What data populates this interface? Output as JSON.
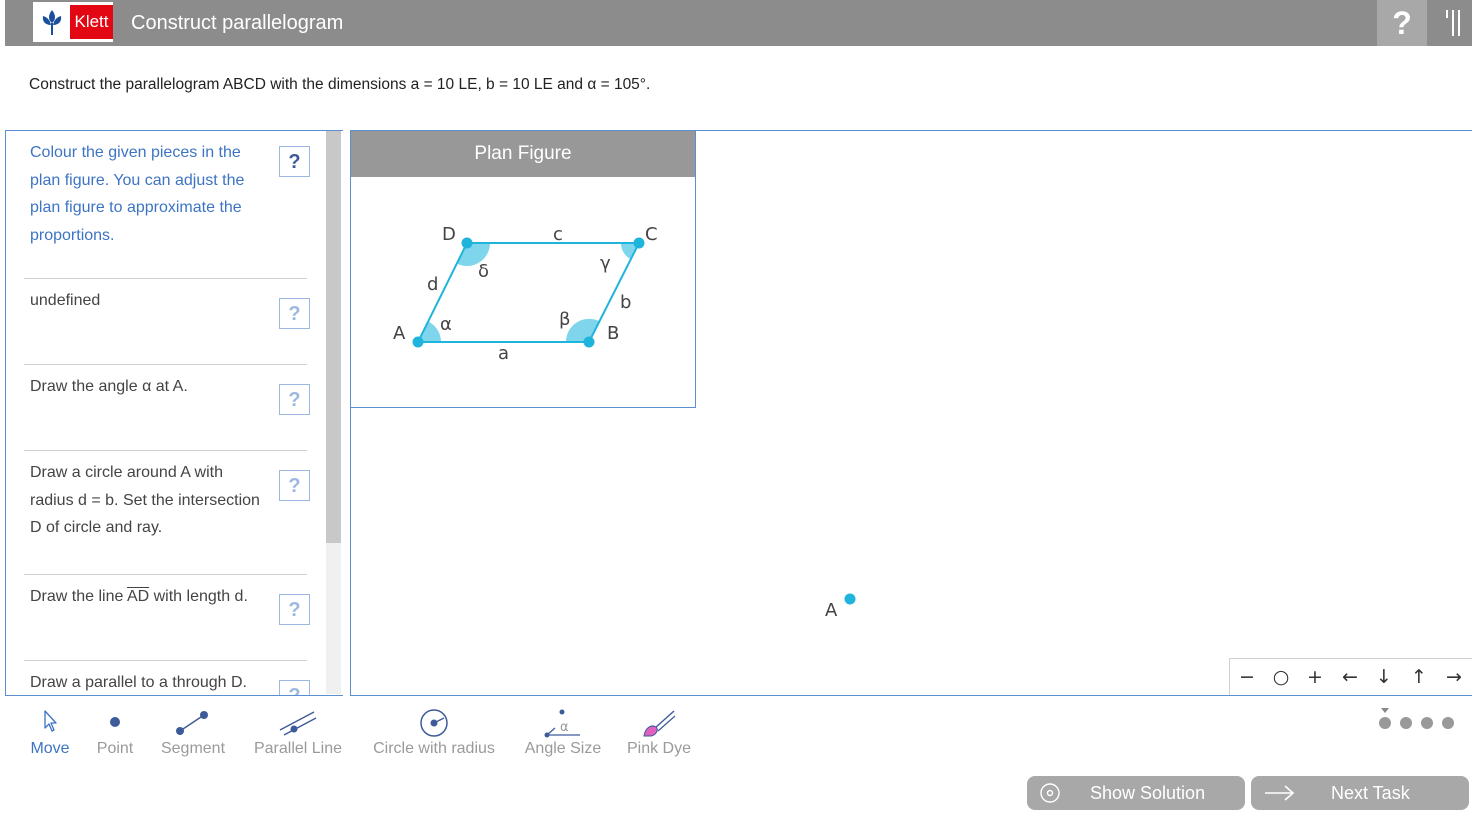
{
  "header": {
    "logo_text": "Klett",
    "title": "Construct parallelogram",
    "help_label": "?"
  },
  "task_text": "Construct the parallelogram ABCD with the dimensions a = 10 LE, b = 10 LE and α = 105°.",
  "steps": [
    {
      "text": "Colour the given pieces in the plan figure. You can adjust the plan figure to approximate the proportions.",
      "help": "?"
    },
    {
      "text": "undefined",
      "help": "?"
    },
    {
      "text": "Draw the angle α at A.",
      "help": "?"
    },
    {
      "text": "Draw a circle around A with radius d = b. Set the intersection D of circle and ray.",
      "help": "?"
    },
    {
      "text_before": "Draw the line ",
      "overline": "AD",
      "text_after": " with length d.",
      "help": "?"
    },
    {
      "text": "Draw a parallel to a through D.",
      "help": "?"
    }
  ],
  "plan_figure": {
    "title": "Plan Figure",
    "vertices": {
      "A": "A",
      "B": "B",
      "C": "C",
      "D": "D"
    },
    "sides": {
      "a": "a",
      "b": "b",
      "c": "c",
      "d": "d"
    },
    "angles": {
      "alpha": "α",
      "beta": "β",
      "gamma": "γ",
      "delta": "δ"
    }
  },
  "canvas": {
    "point_label": "A"
  },
  "zoom_controls": [
    "−",
    "○",
    "+",
    "←",
    "↓",
    "↑",
    "→"
  ],
  "tools": [
    {
      "label": "Move",
      "icon": "cursor-icon",
      "active": true
    },
    {
      "label": "Point",
      "icon": "point-icon",
      "active": false
    },
    {
      "label": "Segment",
      "icon": "segment-icon",
      "active": false
    },
    {
      "label": "Parallel Line",
      "icon": "parallel-line-icon",
      "active": false
    },
    {
      "label": "Circle with radius",
      "icon": "circle-icon",
      "active": false
    },
    {
      "label": "Angle Size",
      "icon": "angle-icon",
      "angle_symbol": "α",
      "active": false
    },
    {
      "label": "Pink Dye",
      "icon": "brush-icon",
      "active": false
    }
  ],
  "actions": {
    "show_solution": "Show Solution",
    "next_task": "Next Task"
  },
  "colors": {
    "header_bg": "#8c8c8c",
    "accent_blue": "#3d74c3",
    "figure_cyan": "#1fb4dc",
    "angle_fill": "#7fd6ec",
    "brand_red": "#e30613",
    "pink": "#e060c0"
  }
}
